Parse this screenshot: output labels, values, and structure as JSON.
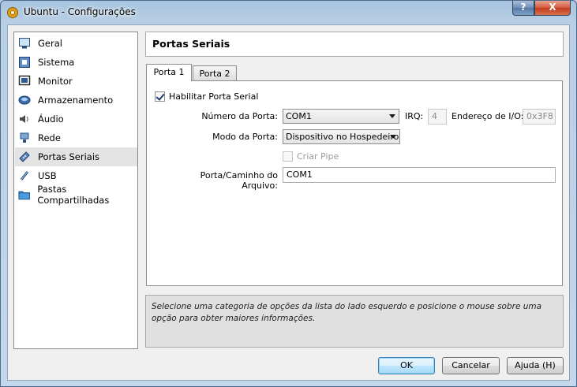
{
  "window": {
    "title": "Ubuntu - Configurações",
    "help_label": "?",
    "close_label": "X"
  },
  "sidebar": {
    "items": [
      {
        "label": "Geral",
        "icon": "monitor-general-icon"
      },
      {
        "label": "Sistema",
        "icon": "chip-icon"
      },
      {
        "label": "Monitor",
        "icon": "display-icon"
      },
      {
        "label": "Armazenamento",
        "icon": "disk-icon"
      },
      {
        "label": "Áudio",
        "icon": "speaker-icon"
      },
      {
        "label": "Rede",
        "icon": "network-icon"
      },
      {
        "label": "Portas Seriais",
        "icon": "serial-port-icon",
        "selected": true
      },
      {
        "label": "USB",
        "icon": "usb-icon"
      },
      {
        "label": "Pastas Compartilhadas",
        "icon": "folder-icon"
      }
    ]
  },
  "page": {
    "title": "Portas Seriais"
  },
  "tabs": [
    {
      "label": "Porta 1",
      "active": true
    },
    {
      "label": "Porta 2",
      "active": false
    }
  ],
  "form": {
    "enable_label": "Habilitar Porta Serial",
    "enable_checked": true,
    "port_number_label": "Número da Porta:",
    "port_number_value": "COM1",
    "irq_label": "IRQ:",
    "irq_value": "4",
    "io_label": "Endereço de I/O:",
    "io_value": "0x3F8",
    "mode_label": "Modo da Porta:",
    "mode_value": "Dispositivo no Hospedeiro",
    "create_pipe_label": "Criar Pipe",
    "create_pipe_checked": false,
    "path_label": "Porta/Caminho do Arquivo:",
    "path_value": "COM1"
  },
  "description": "Selecione uma categoria de opções da lista do lado esquerdo e posicione o mouse sobre uma opção para obter maiores informações.",
  "buttons": {
    "ok": "OK",
    "cancel": "Cancelar",
    "help": "Ajuda (H)"
  },
  "colors": {
    "selection": "#e3e3e3",
    "title_close": "#c33b1d",
    "default_button": "#3c7fb1"
  }
}
